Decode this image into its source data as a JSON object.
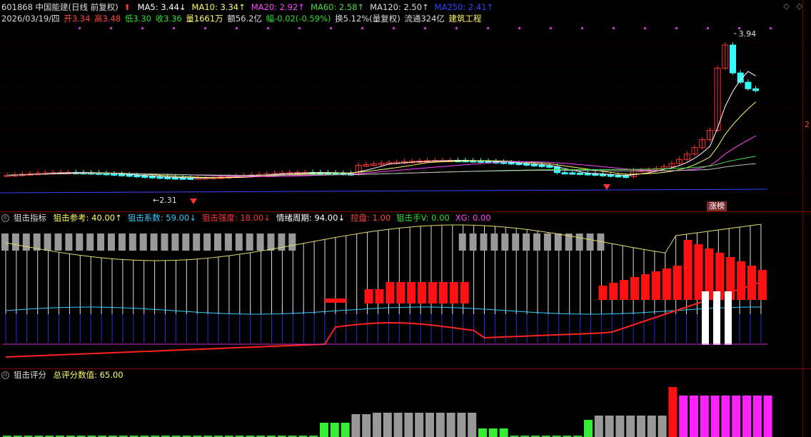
{
  "header": {
    "code_name": "601868 中国能建(日线 前复权)",
    "ma": [
      {
        "label": "MA5: 3.44",
        "arrow": "↓",
        "color": "#ffffff"
      },
      {
        "label": "MA10: 3.34",
        "arrow": "↑",
        "color": "#ffff66"
      },
      {
        "label": "MA20: 2.92",
        "arrow": "↑",
        "color": "#ff44ff"
      },
      {
        "label": "MA60: 2.58",
        "arrow": "↑",
        "color": "#44dd44"
      },
      {
        "label": "MA120: 2.50",
        "arrow": "↑",
        "color": "#dddddd"
      },
      {
        "label": "MA250: 2.41",
        "arrow": "↑",
        "color": "#3344ff"
      }
    ],
    "date": "2026/03/19/四",
    "open": "开3.34",
    "high": "高3.48",
    "low": "低3.30",
    "close": "收3.36",
    "volume": "量1661万",
    "amount": "额56.2亿",
    "change": "幅-0.02(-0.59%)",
    "turnover": "换5.12%(量复权)",
    "float": "流通324亿",
    "sector": "建筑工程"
  },
  "price_chart": {
    "high_label": "3.94",
    "low_label": "2.31",
    "tag_label": "涨榜",
    "side_label": "2"
  },
  "indicator1": {
    "name": "狙击指标",
    "items": [
      {
        "label": "狙击参考: 40.00",
        "arrow": "↑",
        "color": "#ffff66"
      },
      {
        "label": "狙击系数: 59.00",
        "arrow": "↓",
        "color": "#33ccff"
      },
      {
        "label": "狙击强度: 18.00",
        "arrow": "↓",
        "color": "#ff3333"
      },
      {
        "label": "情绪周期: 94.00",
        "arrow": "↓",
        "color": "#ffffff"
      },
      {
        "label": "控盘: 1.00",
        "arrow": "",
        "color": "#ff4444"
      },
      {
        "label": "狙击手V: 0.00",
        "arrow": "",
        "color": "#33dd33"
      },
      {
        "label": "XG: 0.00",
        "arrow": "",
        "color": "#ff44ff"
      }
    ]
  },
  "indicator2": {
    "name": "狙击评分",
    "items": [
      {
        "label": "总评分数值: 65.00",
        "color": "#ffff66"
      }
    ]
  },
  "colors": {
    "up": "#ff3333",
    "down": "#33ffff",
    "separator": "#7a0000"
  },
  "icons": [
    "up-arrow-icon",
    "circle-menu-icon",
    "diamond-icon"
  ]
}
